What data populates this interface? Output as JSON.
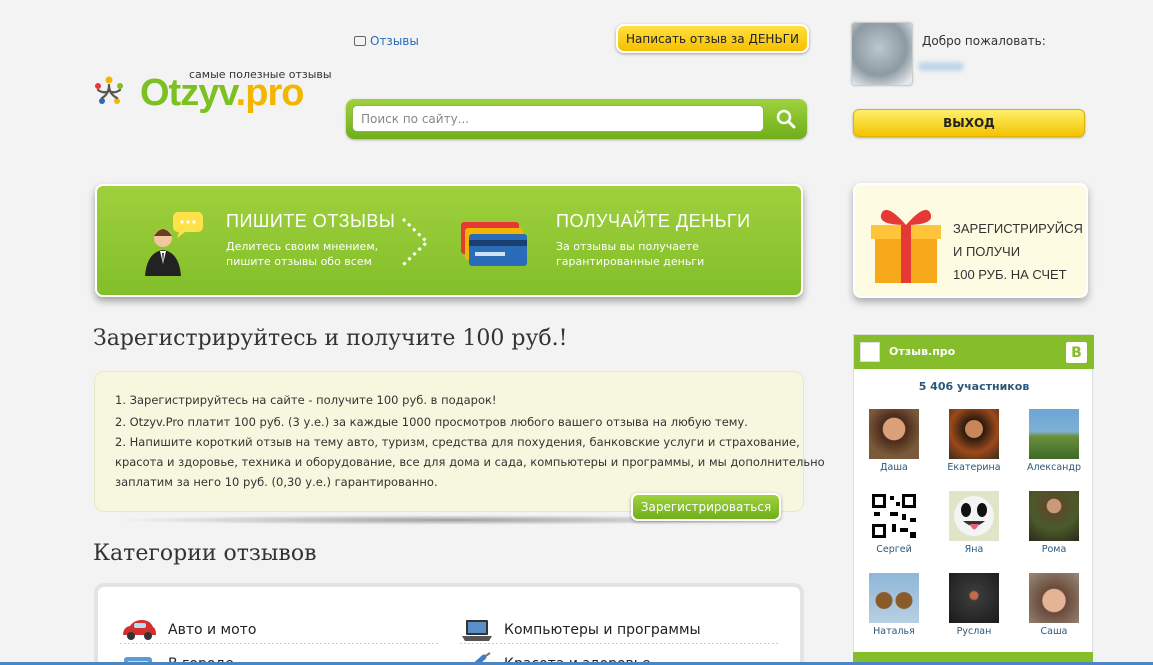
{
  "header": {
    "reviews_link": "Отзывы",
    "write_button": "Написать отзыв за ДЕНЬГИ",
    "logo_tagline": "самые полезные отзывы",
    "logo_part1": "Otzyv",
    "logo_part2": ".pro"
  },
  "search": {
    "placeholder": "Поиск по сайту..."
  },
  "user": {
    "welcome": "Добро пожаловать:",
    "logout": "ВЫХОД"
  },
  "banner": {
    "left_title": "ПИШИТЕ ОТЗЫВЫ",
    "left_sub1": "Делитесь своим мнением,",
    "left_sub2": "пишите отзывы обо всем",
    "right_title": "ПОЛУЧАЙТЕ ДЕНЬГИ",
    "right_sub1": "За отзывы вы получаете",
    "right_sub2": "гарантированные деньги"
  },
  "gift": {
    "line1": "ЗАРЕГИСТРИРУЙСЯ",
    "line2": "И ПОЛУЧИ",
    "line3": "100 РУБ. НА СЧЕТ"
  },
  "register": {
    "heading": "Зарегистрируйтесь и получите 100 руб.!",
    "lines": [
      "1. Зарегистрируйтесь на сайте - получите 100 руб. в подарок!",
      "2. Otzyv.Pro платит 100 руб. (3 у.е.) за каждые 1000 просмотров любого вашего отзыва на любую тему.",
      "2. Напишите короткий отзыв на тему авто, туризм, средства для похудения, банковские услуги и страхование,",
      "красота и здоровье, техника и оборудование, все для дома и сада, компьютеры и программы, и мы дополнительно",
      "заплатим за него 10 руб. (0,30 у.е.) гарантированно."
    ],
    "button": "Зарегистрироваться"
  },
  "categories": {
    "heading": "Категории отзывов",
    "items": [
      "Авто и мото",
      "Компьютеры и программы",
      "В городе",
      "Красота и здоровье"
    ]
  },
  "vk_widget": {
    "title": "Отзыв.про",
    "b_label": "B",
    "members_count": "5 406 участников",
    "members": [
      "Даша",
      "Екатерина",
      "Александр",
      "Сергей",
      "Яна",
      "Рома",
      "Наталья",
      "Руслан",
      "Саша"
    ]
  },
  "colors": {
    "green": "#85bd2b",
    "yellow": "#f5c000",
    "link": "#2a6cb8"
  }
}
